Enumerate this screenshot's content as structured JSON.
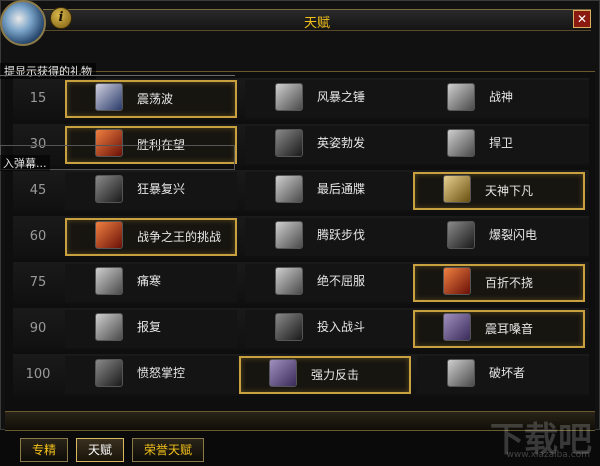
{
  "window": {
    "title": "天赋",
    "info_label": "i",
    "close_label": "✕"
  },
  "overlays": {
    "gift_text": "提显示获得的礼物",
    "barrage_text": "入弹幕..."
  },
  "talent_rows": [
    {
      "level": "15",
      "options": [
        {
          "name": "震荡波",
          "icon": "shockwave-icon",
          "selected": true
        },
        {
          "name": "风暴之锤",
          "icon": "storm-bolt-icon",
          "selected": false
        },
        {
          "name": "战神",
          "icon": "warbringer-icon",
          "selected": false
        }
      ]
    },
    {
      "level": "30",
      "options": [
        {
          "name": "胜利在望",
          "icon": "victory-rush-icon",
          "selected": true
        },
        {
          "name": "英姿勃发",
          "icon": "dauntless-icon",
          "selected": false
        },
        {
          "name": "捍卫",
          "icon": "bulwark-icon",
          "selected": false
        }
      ]
    },
    {
      "level": "45",
      "options": [
        {
          "name": "狂暴复兴",
          "icon": "berserk-icon",
          "selected": false
        },
        {
          "name": "最后通牒",
          "icon": "ultimatum-icon",
          "selected": false
        },
        {
          "name": "天神下凡",
          "icon": "avatar-icon",
          "selected": true
        }
      ]
    },
    {
      "level": "60",
      "options": [
        {
          "name": "战争之王的挑战",
          "icon": "warlord-challenge-icon",
          "selected": true
        },
        {
          "name": "腾跃步伐",
          "icon": "bounding-stride-icon",
          "selected": false
        },
        {
          "name": "爆裂闪电",
          "icon": "crackling-thunder-icon",
          "selected": false
        }
      ]
    },
    {
      "level": "75",
      "options": [
        {
          "name": "痛寒",
          "icon": "pain-icon",
          "selected": false
        },
        {
          "name": "绝不屈服",
          "icon": "never-surrender-icon",
          "selected": false
        },
        {
          "name": "百折不挠",
          "icon": "indomitable-icon",
          "selected": true
        }
      ]
    },
    {
      "level": "90",
      "options": [
        {
          "name": "报复",
          "icon": "vengeance-icon",
          "selected": false
        },
        {
          "name": "投入战斗",
          "icon": "into-battle-icon",
          "selected": false
        },
        {
          "name": "震耳嗓音",
          "icon": "booming-voice-icon",
          "selected": true
        }
      ]
    },
    {
      "level": "100",
      "options": [
        {
          "name": "愤怒掌控",
          "icon": "anger-management-icon",
          "selected": false
        },
        {
          "name": "强力反击",
          "icon": "heavy-repercussions-icon",
          "selected": true
        },
        {
          "name": "破坏者",
          "icon": "ravager-icon",
          "selected": false
        }
      ]
    }
  ],
  "tabs": [
    {
      "label": "专精",
      "active": false
    },
    {
      "label": "天赋",
      "active": true
    },
    {
      "label": "荣誉天赋",
      "active": false
    }
  ],
  "watermark": {
    "text": "下载吧",
    "url": "www.xiazaiba.com"
  }
}
